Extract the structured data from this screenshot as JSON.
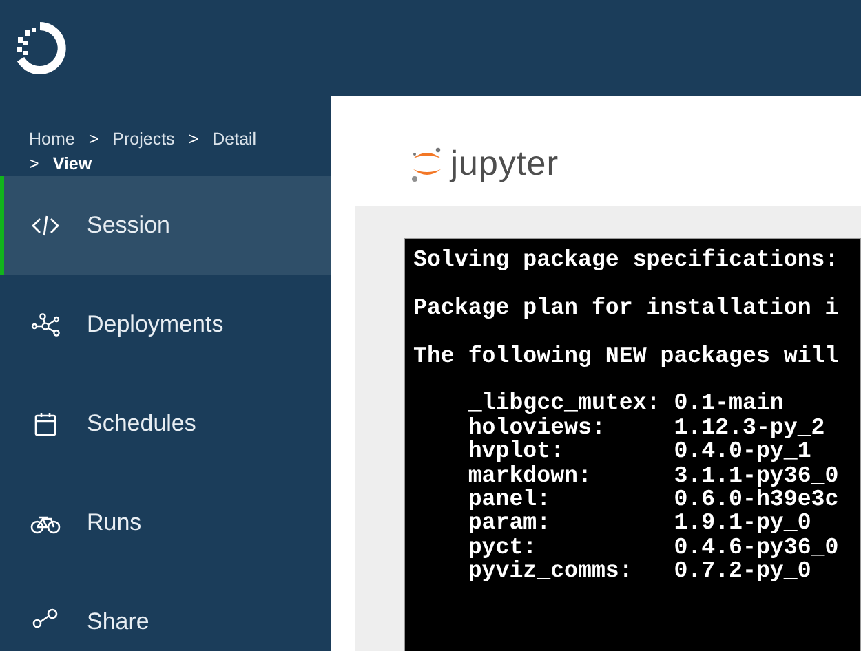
{
  "breadcrumb": [
    {
      "label": "Home",
      "current": false
    },
    {
      "label": "Projects",
      "current": false
    },
    {
      "label": "Detail",
      "current": false
    },
    {
      "label": "View",
      "current": true
    }
  ],
  "breadcrumb_separator": ">",
  "sidebar": {
    "items": [
      {
        "label": "Session",
        "selected": true
      },
      {
        "label": "Deployments",
        "selected": false
      },
      {
        "label": "Schedules",
        "selected": false
      },
      {
        "label": "Runs",
        "selected": false
      },
      {
        "label": "Share",
        "selected": false
      }
    ]
  },
  "notebook": {
    "brand": "jupyter",
    "terminal_blocks": [
      [
        "Solving package specifications:"
      ],
      [
        "Package plan for installation i"
      ],
      [
        "The following NEW packages will"
      ],
      [
        "    _libgcc_mutex: 0.1-main",
        "    holoviews:     1.12.3-py_2",
        "    hvplot:        0.4.0-py_1",
        "    markdown:      3.1.1-py36_0",
        "    panel:         0.6.0-h39e3c",
        "    param:         1.9.1-py_0",
        "    pyct:          0.4.6-py36_0",
        "    pyviz_comms:   0.7.2-py_0"
      ]
    ]
  }
}
